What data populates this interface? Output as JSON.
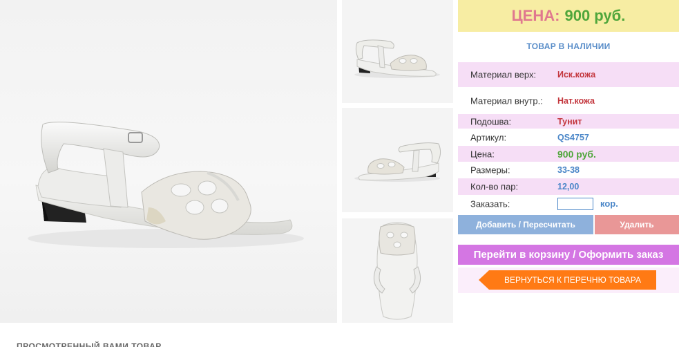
{
  "product": {
    "main_image_alt": "Белые босоножки",
    "thumbnails": [
      "Вид сбоку (носок влево)",
      "Вид сбоку (носок вправо)",
      "Вид сверху"
    ]
  },
  "price_box": {
    "label": "ЦЕНА:",
    "value": "900 руб."
  },
  "stock_status": "ТОВАР В НАЛИЧИИ",
  "specs": [
    {
      "key": "Материал верх:",
      "value": "Иск.кожа"
    },
    {
      "key": "Материал внутр.:",
      "value": "Нат.кожа"
    },
    {
      "key": "Подошва:",
      "value": "Тунит"
    },
    {
      "key": "Артикул:",
      "value": "QS4757"
    },
    {
      "key": "Цена:",
      "value": "900 руб."
    },
    {
      "key": "Размеры:",
      "value": "33-38"
    },
    {
      "key": "Кол-во пар:",
      "value": "12,00"
    }
  ],
  "order": {
    "label": "Заказать:",
    "value": "",
    "unit": "кор."
  },
  "buttons": {
    "add": "Добавить / Пересчитать",
    "delete": "Удалить",
    "cart": "Перейти в корзину / Оформить заказ",
    "back": "ВЕРНУТЬСЯ К ПЕРЕЧНЮ ТОВАРА"
  },
  "bottom": {
    "partial_text": "ПРОСМОТРЕННЫЙ ВАМИ ТОВАР"
  },
  "colors": {
    "price_bg": "#f7eda3",
    "price_label": "#e0788f",
    "price_value": "#4fa63b",
    "spec_pink": "#f6def6",
    "value_red": "#c3363d",
    "value_blue": "#4a86c8",
    "btn_add": "#8eb1dc",
    "btn_delete": "#e99797",
    "btn_cart": "#d476e3",
    "btn_back": "#ff7a14"
  }
}
